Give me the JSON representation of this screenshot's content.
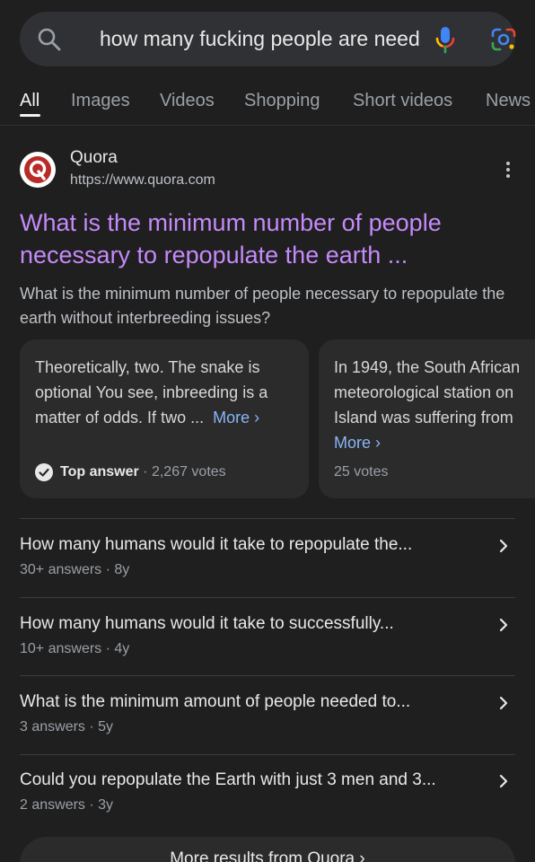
{
  "search": {
    "query": "how many fucking people are need"
  },
  "tabs": [
    "All",
    "Images",
    "Videos",
    "Shopping",
    "Short videos",
    "News"
  ],
  "result": {
    "site_name": "Quora",
    "site_url": "https://www.quora.com",
    "title": "What is the minimum number of people necessary to repopulate the earth ...",
    "snippet": "What is the minimum number of people necessary to repopulate the earth without interbreeding issues?"
  },
  "answers": [
    {
      "lines": [
        "Theoretically, two. The snake is",
        "optional You see, inbreeding is a",
        "matter of odds. If two ..."
      ],
      "more_label": "More",
      "top_label": "Top answer",
      "votes": "· 2,267 votes"
    },
    {
      "lines": [
        "In 1949, the South African",
        "meteorological station on",
        "Island was suffering from"
      ],
      "more_label": "More",
      "votes": "25 votes"
    }
  ],
  "related": [
    {
      "title": "How many humans would it take to repopulate the...",
      "meta": "30+ answers · 8y"
    },
    {
      "title": "How many humans would it take to successfully...",
      "meta": "10+ answers · 4y"
    },
    {
      "title": "What is the minimum amount of people needed to...",
      "meta": "3 answers · 5y"
    },
    {
      "title": "Could you repopulate the Earth with just 3 men and 3...",
      "meta": "2 answers · 3y"
    }
  ],
  "more_results_label": "More results from Quora",
  "colors": {
    "background": "#1f1f1f",
    "visited_link": "#c58af9",
    "more_link": "#8ab4f8"
  }
}
